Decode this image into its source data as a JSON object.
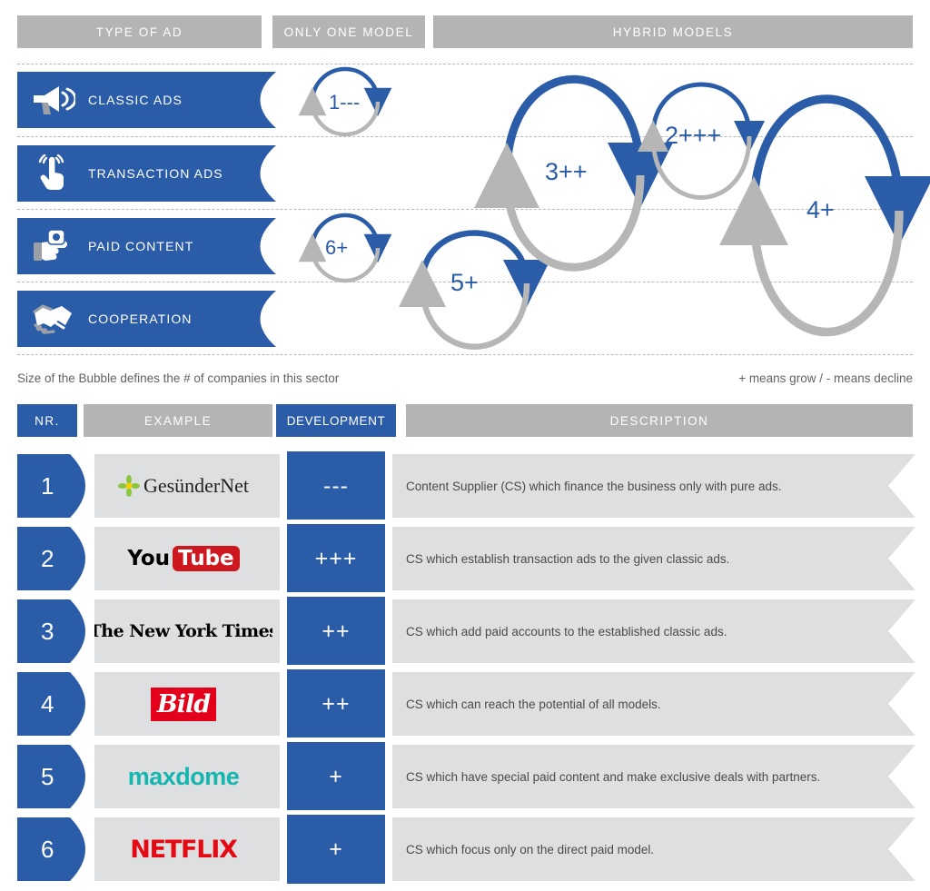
{
  "categories": [
    {
      "label": "TYPE OF AD"
    },
    {
      "label": "ONLY ONE MODEL"
    },
    {
      "label": "HYBRID MODELS"
    }
  ],
  "matrix_rows": [
    {
      "label": "CLASSIC ADS",
      "icon": "megaphone-icon"
    },
    {
      "label": "TRANSACTION ADS",
      "icon": "tap-finger-icon"
    },
    {
      "label": "PAID CONTENT",
      "icon": "hand-holding-coin-icon"
    },
    {
      "label": "COOPERATION",
      "icon": "handshake-icon"
    }
  ],
  "loops": [
    {
      "id": "1",
      "label": "1---",
      "rows": "classic-ads"
    },
    {
      "id": "6",
      "label": "6+",
      "rows": "paid-content"
    },
    {
      "id": "5",
      "label": "5+",
      "rows": "paid-content-to-cooperation"
    },
    {
      "id": "3",
      "label": "3++",
      "rows": "classic-ads-to-paid-content"
    },
    {
      "id": "2",
      "label": "2+++",
      "rows": "classic-ads-to-transaction-ads"
    },
    {
      "id": "4",
      "label": "4+",
      "rows": "classic-ads-to-cooperation"
    }
  ],
  "captions": {
    "left": "Size of the Bubble defines the # of companies in this sector",
    "right": "+ means grow / - means decline"
  },
  "table": {
    "headers": [
      "NR.",
      "EXAMPLE",
      "DEVELOPMENT",
      "DESCRIPTION"
    ],
    "rows": [
      {
        "nr": "1",
        "example": "GesünderNet",
        "logo": "gesundernet-logo",
        "development": "---",
        "description": "Content Supplier (CS) which finance the business only with pure ads."
      },
      {
        "nr": "2",
        "example": "YouTube",
        "logo": "youtube-logo",
        "logo_part1": "You",
        "logo_part2": "Tube",
        "development": "+++",
        "description": "CS which establish transaction ads to the given classic ads."
      },
      {
        "nr": "3",
        "example": "The New York Times",
        "logo": "new-york-times-logo",
        "development": "++",
        "description": "CS which add paid accounts to the established classic ads."
      },
      {
        "nr": "4",
        "example": "Bild",
        "logo": "bild-logo",
        "development": "++",
        "description": "CS which can reach the potential of all models."
      },
      {
        "nr": "5",
        "example": "maxdome",
        "logo": "maxdome-logo",
        "development": "+",
        "description": "CS which have special paid content and make exclusive deals with partners."
      },
      {
        "nr": "6",
        "example": "NETFLIX",
        "logo": "netflix-logo",
        "development": "+",
        "description": "CS which focus only on the direct paid model."
      }
    ]
  },
  "colors": {
    "blue": "#2a5ca8",
    "gray": "#b4b4b4",
    "light_gray": "#dedfe1",
    "loop_gray": "#b6b6b6"
  }
}
